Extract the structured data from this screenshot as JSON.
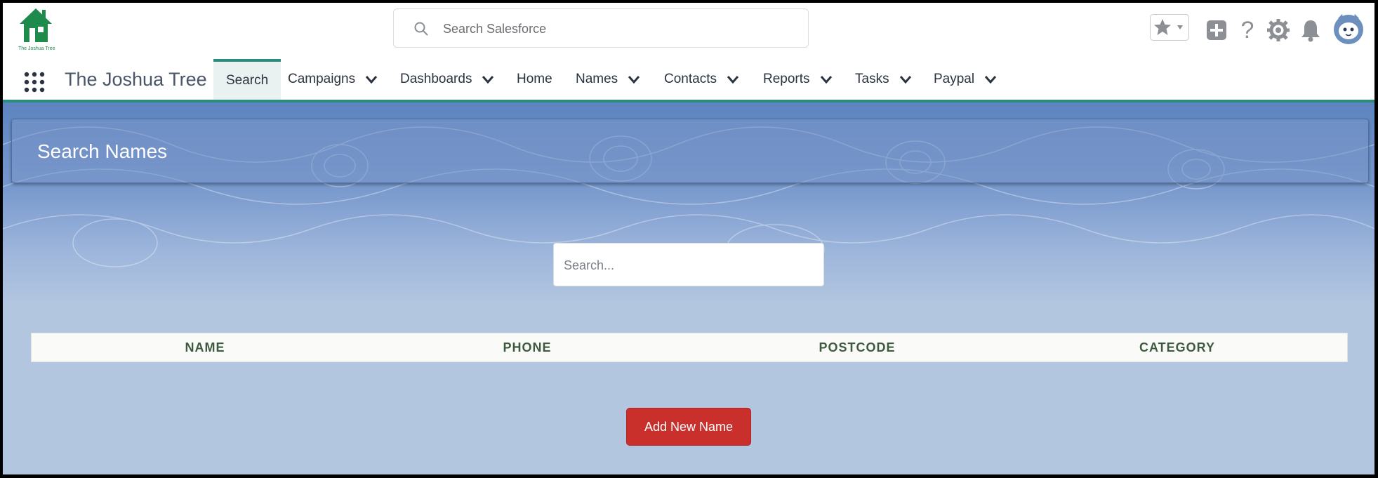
{
  "brand": {
    "logo_text": "The Joshua Tree",
    "app_name": "The Joshua Tree",
    "accent": "#2a8c7a",
    "logo_color": "#1e8a4c"
  },
  "header": {
    "search_placeholder": "Search Salesforce",
    "utility_icons": [
      "star-icon",
      "add-icon",
      "help-icon",
      "setup-gear-icon",
      "notification-bell-icon",
      "avatar"
    ]
  },
  "nav": {
    "items": [
      {
        "label": "Search",
        "active": true,
        "dropdown": false
      },
      {
        "label": "Campaigns",
        "dropdown": true
      },
      {
        "label": "Dashboards",
        "dropdown": true
      },
      {
        "label": "Home",
        "dropdown": false
      },
      {
        "label": "Names",
        "dropdown": true
      },
      {
        "label": "Contacts",
        "dropdown": true
      },
      {
        "label": "Reports",
        "dropdown": true
      },
      {
        "label": "Tasks",
        "dropdown": true
      },
      {
        "label": "Paypal",
        "dropdown": true
      }
    ]
  },
  "main": {
    "card_title": "Search Names",
    "search_placeholder": "Search...",
    "columns": [
      "NAME",
      "PHONE",
      "POSTCODE",
      "CATEGORY"
    ],
    "add_button": "Add New Name",
    "button_color": "#c9302c"
  }
}
